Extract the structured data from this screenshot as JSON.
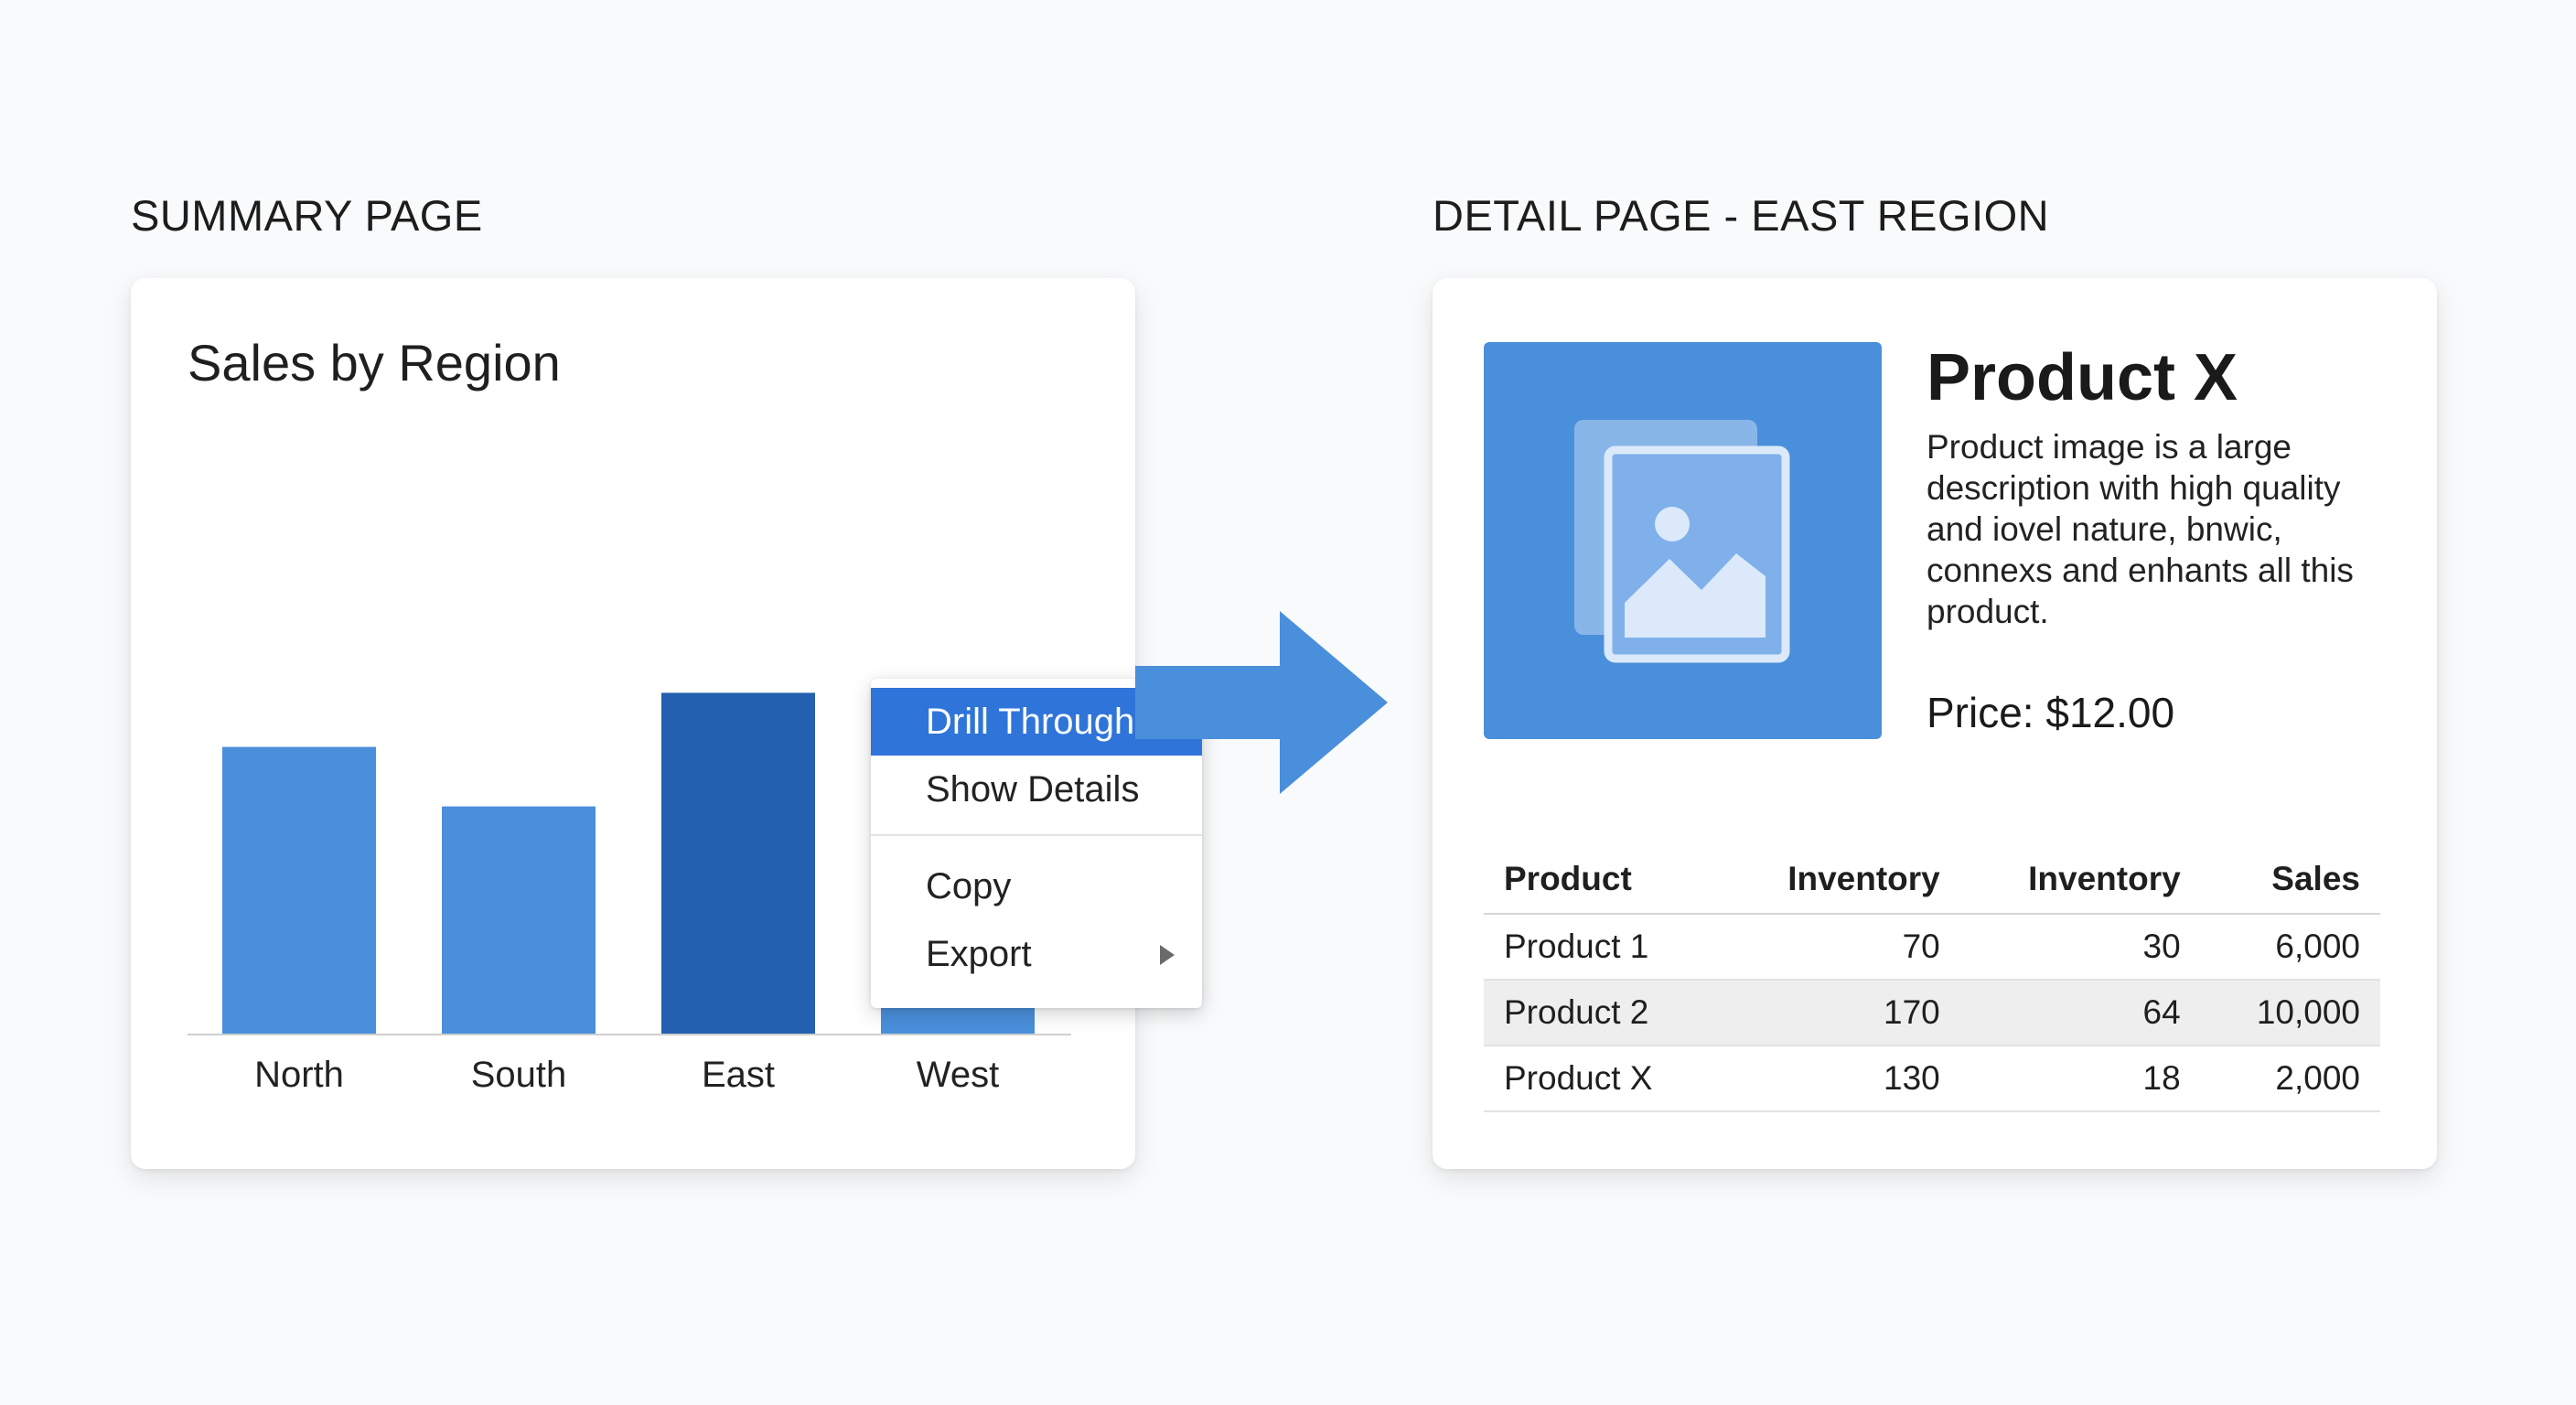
{
  "labels": {
    "summary_page": "SUMMARY PAGE",
    "detail_page": "DETAIL PAGE - EAST REGION"
  },
  "summary": {
    "chart_title": "Sales by Region"
  },
  "chart_data": {
    "type": "bar",
    "title": "Sales by Region",
    "categories": [
      "North",
      "South",
      "East",
      "West"
    ],
    "values": [
      53,
      42,
      63,
      46
    ],
    "ylim": [
      0,
      70
    ],
    "highlight_category": "East",
    "grid": false,
    "colors": {
      "bar": "#4a8fdb",
      "bar_selected": "#2360b0",
      "axis": "#cfcfcf"
    }
  },
  "context_menu": {
    "items": [
      {
        "label": "Drill Through",
        "highlighted": true
      },
      {
        "label": "Show Details"
      },
      {
        "label": "Copy"
      },
      {
        "label": "Export",
        "has_submenu": true
      }
    ]
  },
  "detail": {
    "product_name": "Product X",
    "description": "Product image is a large description with high quality and iovel nature, bnwic, connexs and enhants all this product.",
    "price": "Price: $12.00",
    "image_icon": "image-icon",
    "table": {
      "headers": [
        "Product",
        "Inventory",
        "Inventory",
        "Sales"
      ],
      "rows": [
        [
          "Product 1",
          "70",
          "30",
          "6,000"
        ],
        [
          "Product 2",
          "170",
          "64",
          "10,000"
        ],
        [
          "Product X",
          "130",
          "18",
          "2,000"
        ]
      ]
    }
  },
  "colors": {
    "accent": "#2f74d9",
    "image_tile": "#4a8fdb",
    "arrow": "#4a8fdb"
  }
}
